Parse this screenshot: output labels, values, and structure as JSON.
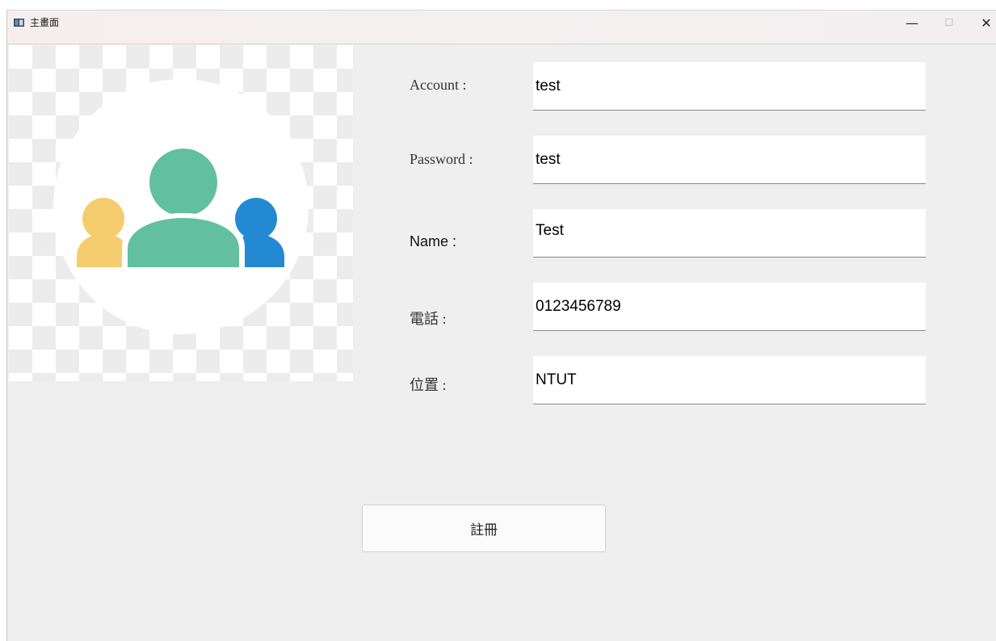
{
  "window": {
    "title": "主畫面",
    "minimize_glyph": "—",
    "maximize_glyph": "☐",
    "close_glyph": "✕"
  },
  "form": {
    "account": {
      "label": "Account :",
      "value": "test"
    },
    "password": {
      "label": "Password :",
      "value": "test"
    },
    "name": {
      "label": "Name :",
      "value": "Test"
    },
    "phone": {
      "label": "電話 :",
      "value": "0123456789"
    },
    "location": {
      "label": "位置 :",
      "value": "NTUT"
    }
  },
  "register_button": {
    "label": "註冊"
  },
  "colors": {
    "window_bg": "#efefef",
    "avatar_center": "#62bfa0",
    "avatar_left": "#f5cd6e",
    "avatar_right": "#2389d3"
  },
  "icons": {
    "app": "app-window-icon",
    "avatar": "user-group-icon"
  }
}
